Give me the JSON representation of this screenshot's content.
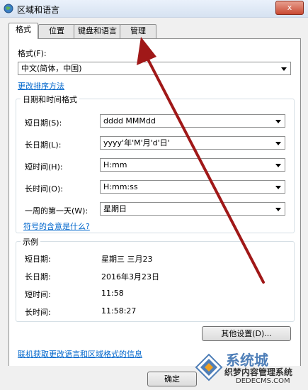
{
  "window": {
    "title": "区域和语言",
    "close_label": "x"
  },
  "tabs": [
    {
      "label": "格式",
      "active": true
    },
    {
      "label": "位置",
      "active": false
    },
    {
      "label": "键盘和语言",
      "active": false
    },
    {
      "label": "管理",
      "active": false
    }
  ],
  "format": {
    "label": "格式(F):",
    "value": "中文(简体，中国)",
    "sort_link": "更改排序方法"
  },
  "datetime_group": {
    "title": "日期和时间格式",
    "rows": [
      {
        "label": "短日期(S):",
        "value": "dddd  MMMdd"
      },
      {
        "label": "长日期(L):",
        "value": "yyyy'年'M'月'd'日'"
      },
      {
        "label": "短时间(H):",
        "value": "H:mm"
      },
      {
        "label": "长时间(O):",
        "value": "H:mm:ss"
      },
      {
        "label": "一周的第一天(W):",
        "value": "星期日"
      }
    ],
    "symbol_link": "符号的含意是什么?"
  },
  "example_group": {
    "title": "示例",
    "rows": [
      {
        "label": "短日期:",
        "value": "星期三  三月23"
      },
      {
        "label": "长日期:",
        "value": "2016年3月23日"
      },
      {
        "label": "短时间:",
        "value": "11:58"
      },
      {
        "label": "长时间:",
        "value": "11:58:27"
      }
    ]
  },
  "other_settings_label": "其他设置(D)...",
  "online_link": "联机获取更改语言和区域格式的信息",
  "ok_label": "确定",
  "watermark": {
    "line1": "系统城",
    "line2": "织梦内容管理系统",
    "line3": "DEDECMS.COM"
  },
  "colors": {
    "link": "#0066cc",
    "arrow": "#a01818",
    "accent": "#4f7fb8"
  }
}
